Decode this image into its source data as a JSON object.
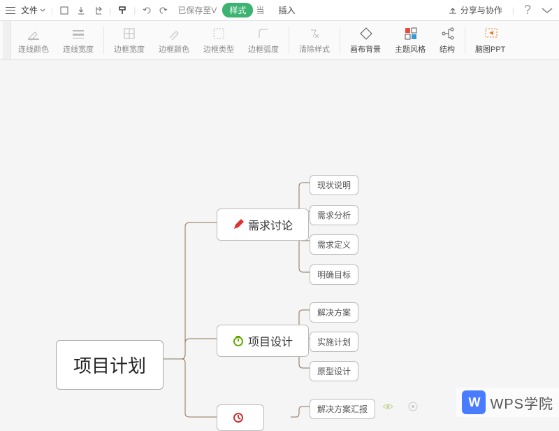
{
  "top": {
    "file": "文件",
    "saved": "已保存至V",
    "tab_style": "样式",
    "tab_insert": "插入",
    "tab_suffix": "当",
    "share": "分享与协作"
  },
  "ribbon": {
    "line_color": "连线颜色",
    "line_width": "连线宽度",
    "border_width": "边框宽度",
    "border_color": "边框颜色",
    "border_type": "边框类型",
    "border_arc": "边框弧度",
    "clear_style": "清除样式",
    "canvas_bg": "画布背景",
    "theme": "主题风格",
    "structure": "结构",
    "ppt": "脑图PPT"
  },
  "mind": {
    "root": "项目计划",
    "n1": {
      "label": "需求讨论",
      "children": [
        "现状说明",
        "需求分析",
        "需求定义",
        "明确目标"
      ]
    },
    "n2": {
      "label": "项目设计",
      "children": [
        "解决方案",
        "实施计划",
        "原型设计"
      ]
    },
    "n3": {
      "label": "",
      "children": [
        "解决方案汇报"
      ]
    }
  },
  "watermark": {
    "badge": "W",
    "text": "WPS学院"
  }
}
